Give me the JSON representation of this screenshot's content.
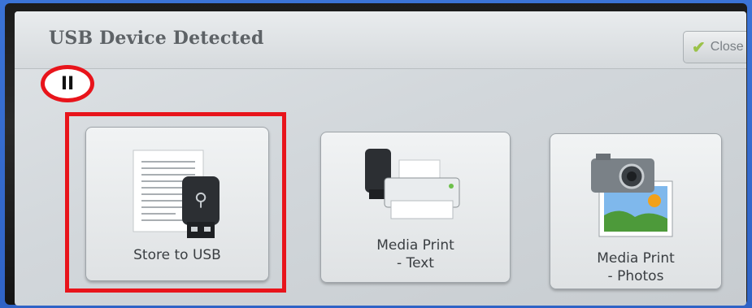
{
  "dialog": {
    "title": "USB Device Detected",
    "close_label": "Close"
  },
  "options": [
    {
      "label": "Store to USB"
    },
    {
      "label_line1": "Media Print",
      "label_line2": "- Text"
    },
    {
      "label_line1": "Media Print",
      "label_line2": "- Photos"
    }
  ],
  "annotation": {
    "badge": "II",
    "highlight_color": "#e8141b"
  }
}
